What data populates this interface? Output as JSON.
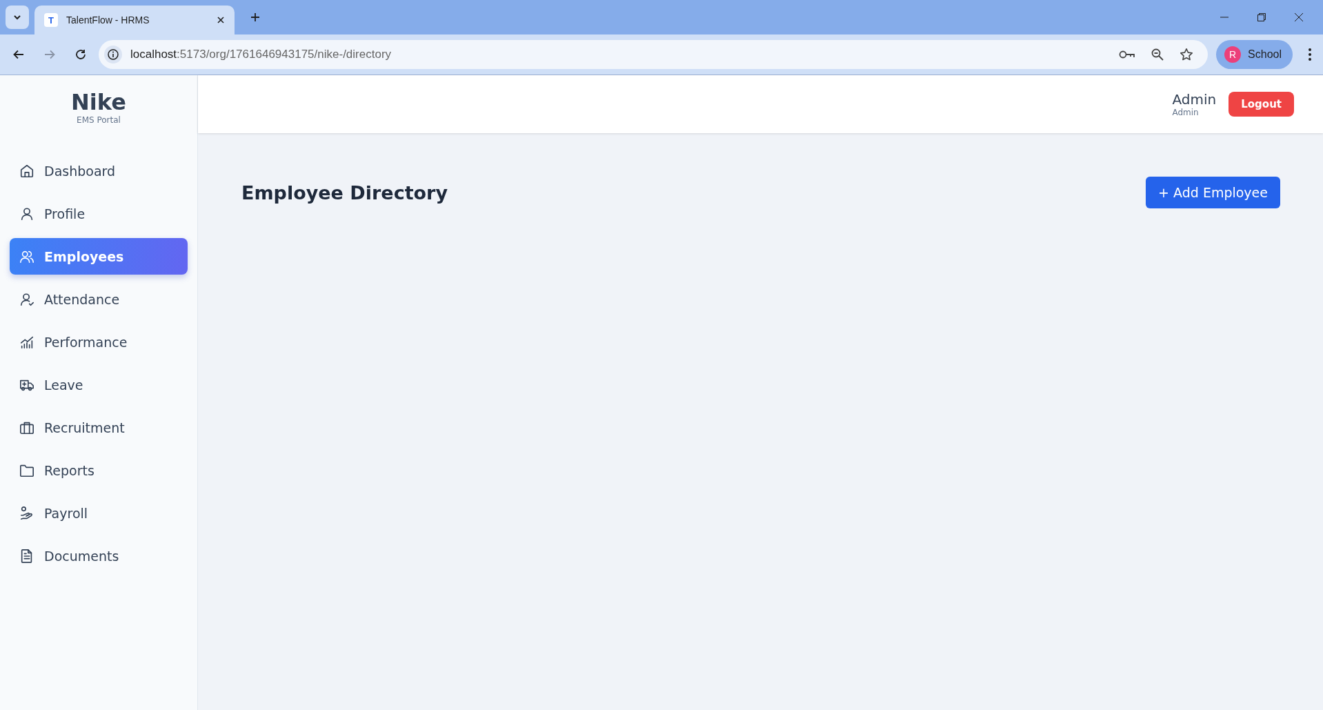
{
  "browser": {
    "tab": {
      "title": "TalentFlow - HRMS",
      "favicon": "T"
    },
    "url": {
      "host": "localhost",
      "path": ":5173/org/1761646943175/nike-/directory"
    },
    "profile": {
      "initial": "R",
      "name": "School"
    }
  },
  "sidebar": {
    "brand": "Nike",
    "subtitle": "EMS Portal",
    "items": [
      {
        "label": "Dashboard",
        "selected": false
      },
      {
        "label": "Profile",
        "selected": false
      },
      {
        "label": "Employees",
        "selected": true
      },
      {
        "label": "Attendance",
        "selected": false
      },
      {
        "label": "Performance",
        "selected": false
      },
      {
        "label": "Leave",
        "selected": false
      },
      {
        "label": "Recruitment",
        "selected": false
      },
      {
        "label": "Reports",
        "selected": false
      },
      {
        "label": "Payroll",
        "selected": false
      },
      {
        "label": "Documents",
        "selected": false
      }
    ]
  },
  "header": {
    "user_name": "Admin",
    "user_role": "Admin",
    "logout": "Logout"
  },
  "page": {
    "title": "Employee Directory",
    "add_button": "+ Add Employee"
  }
}
